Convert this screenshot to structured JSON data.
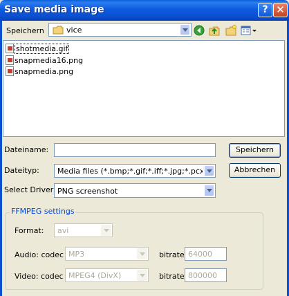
{
  "window": {
    "title": "Save media image"
  },
  "location": {
    "label": "Speichern",
    "folder": "vice"
  },
  "files": [
    {
      "name": "shotmedia.gif",
      "selected": true
    },
    {
      "name": "snapmedia16.png",
      "selected": false
    },
    {
      "name": "snapmedia.png",
      "selected": false
    }
  ],
  "filename": {
    "label": "Dateiname:",
    "value": ""
  },
  "filetype": {
    "label": "Dateityp:",
    "value": "Media files (*.bmp;*.gif;*.iff;*.jpg;*.pcx;*.png;*"
  },
  "driver": {
    "label": "Select Driver:",
    "value": "PNG screenshot"
  },
  "buttons": {
    "save": "Speichern",
    "cancel": "Abbrechen"
  },
  "ffmpeg": {
    "group_title": "FFMPEG settings",
    "format_label": "Format:",
    "format_value": "avi",
    "audio_label": "Audio: codec",
    "audio_value": "MP3",
    "audio_bitrate_label": "bitrate",
    "audio_bitrate_value": "64000",
    "video_label": "Video: codec",
    "video_value": "MPEG4 (DivX)",
    "video_bitrate_label": "bitrate",
    "video_bitrate_value": "800000"
  },
  "icons": [
    "folder-icon",
    "back-icon",
    "up-folder-icon",
    "new-folder-icon",
    "view-menu-icon",
    "help-icon",
    "close-icon",
    "image-file-icon"
  ],
  "colors": {
    "titlebar": "#0a4fcf",
    "accent": "#0046d5",
    "background": "#ece9d8"
  }
}
